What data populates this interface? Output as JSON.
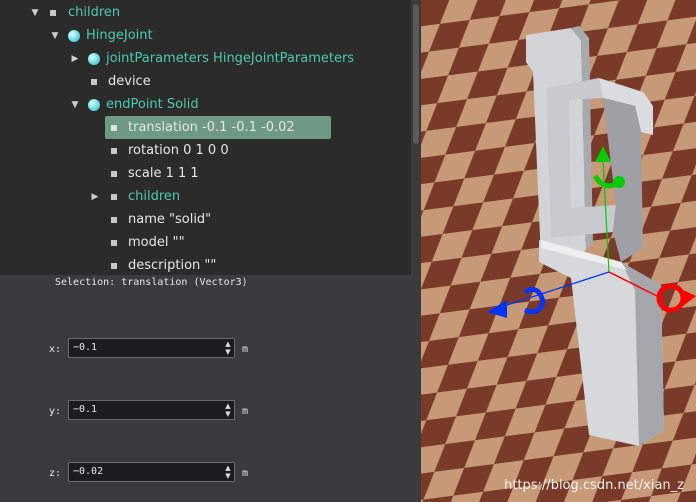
{
  "tree": {
    "rows": [
      {
        "label": "children"
      },
      {
        "label": "HingeJoint"
      },
      {
        "label": "jointParameters HingeJointParameters"
      },
      {
        "label": "device"
      },
      {
        "label": "endPoint Solid"
      },
      {
        "label": "translation -0.1 -0.1 -0.02"
      },
      {
        "label": "rotation 0 1 0 0"
      },
      {
        "label": "scale 1 1 1"
      },
      {
        "label": "children"
      },
      {
        "label": "name \"solid\""
      },
      {
        "label": "model \"\""
      },
      {
        "label": "description \"\""
      }
    ],
    "selected_index": 5,
    "teal_color": "#4ec9b0"
  },
  "selection": {
    "title": "Selection: translation (Vector3)"
  },
  "fields": {
    "x": {
      "label": "x:",
      "value": "−0.1",
      "unit": "m"
    },
    "y": {
      "label": "y:",
      "value": "−0.1",
      "unit": "m"
    },
    "z": {
      "label": "z:",
      "value": "−0.02",
      "unit": "m"
    }
  },
  "viewport": {
    "watermark": "https://blog.csdn.net/xian_z",
    "gizmo_colors": {
      "x": "#ff0000",
      "y": "#00cc00",
      "z": "#0033ff"
    }
  }
}
